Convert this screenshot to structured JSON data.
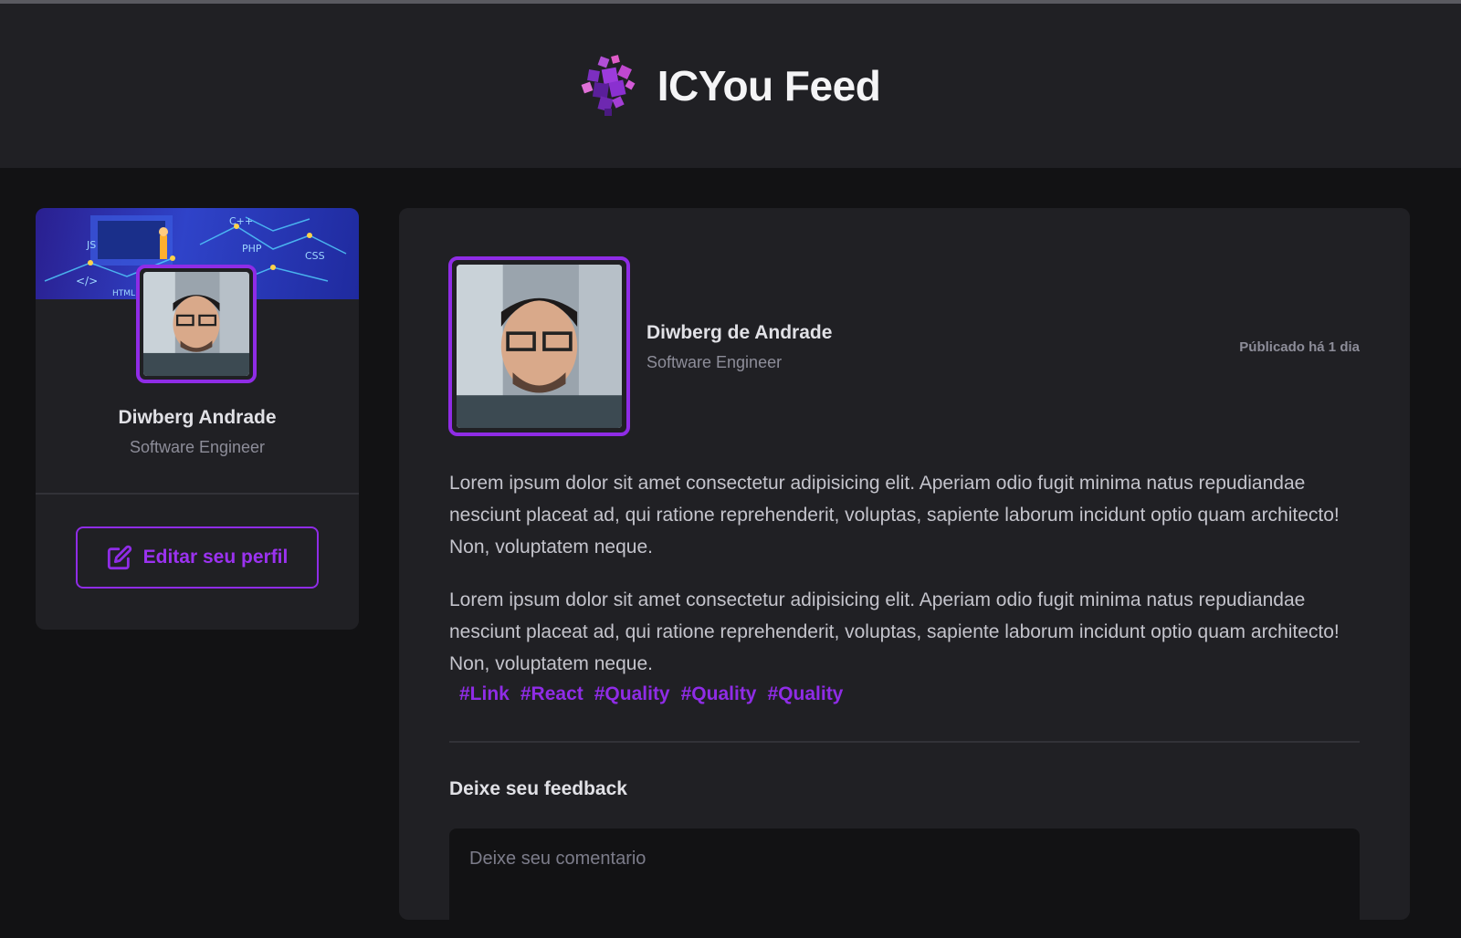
{
  "app": {
    "title": "ICYou Feed",
    "logo_icon": "cube-cluster-logo"
  },
  "sidebar": {
    "name": "Diwberg Andrade",
    "role": "Software Engineer",
    "edit_button": {
      "label": "Editar seu perfil",
      "icon": "edit-icon"
    },
    "cover_labels": [
      "JS",
      "C++",
      "PHP",
      "CSS",
      "</>",
      "HTML"
    ]
  },
  "post": {
    "author": {
      "name": "Diwberg de Andrade",
      "role": "Software Engineer"
    },
    "published": "Públicado há 1 dia",
    "paragraphs": [
      "Lorem ipsum dolor sit amet consectetur adipisicing elit. Aperiam odio fugit minima natus repudiandae nesciunt placeat ad, qui ratione reprehenderit, voluptas, sapiente laborum incidunt optio quam architecto! Non, voluptatem neque.",
      "Lorem ipsum dolor sit amet consectetur adipisicing elit. Aperiam odio fugit minima natus repudiandae nesciunt placeat ad, qui ratione reprehenderit, voluptas, sapiente laborum incidunt optio quam architecto! Non, voluptatem neque."
    ],
    "tags": [
      "#Link",
      "#React",
      "#Quality",
      "#Quality",
      "#Quality"
    ],
    "feedback": {
      "title": "Deixe seu feedback",
      "placeholder": "Deixe seu comentario",
      "value": ""
    }
  },
  "colors": {
    "accent": "#8f2ce6",
    "background": "#121214",
    "surface": "#202024",
    "text": "#e1e1e6",
    "muted": "#8d8d99"
  }
}
